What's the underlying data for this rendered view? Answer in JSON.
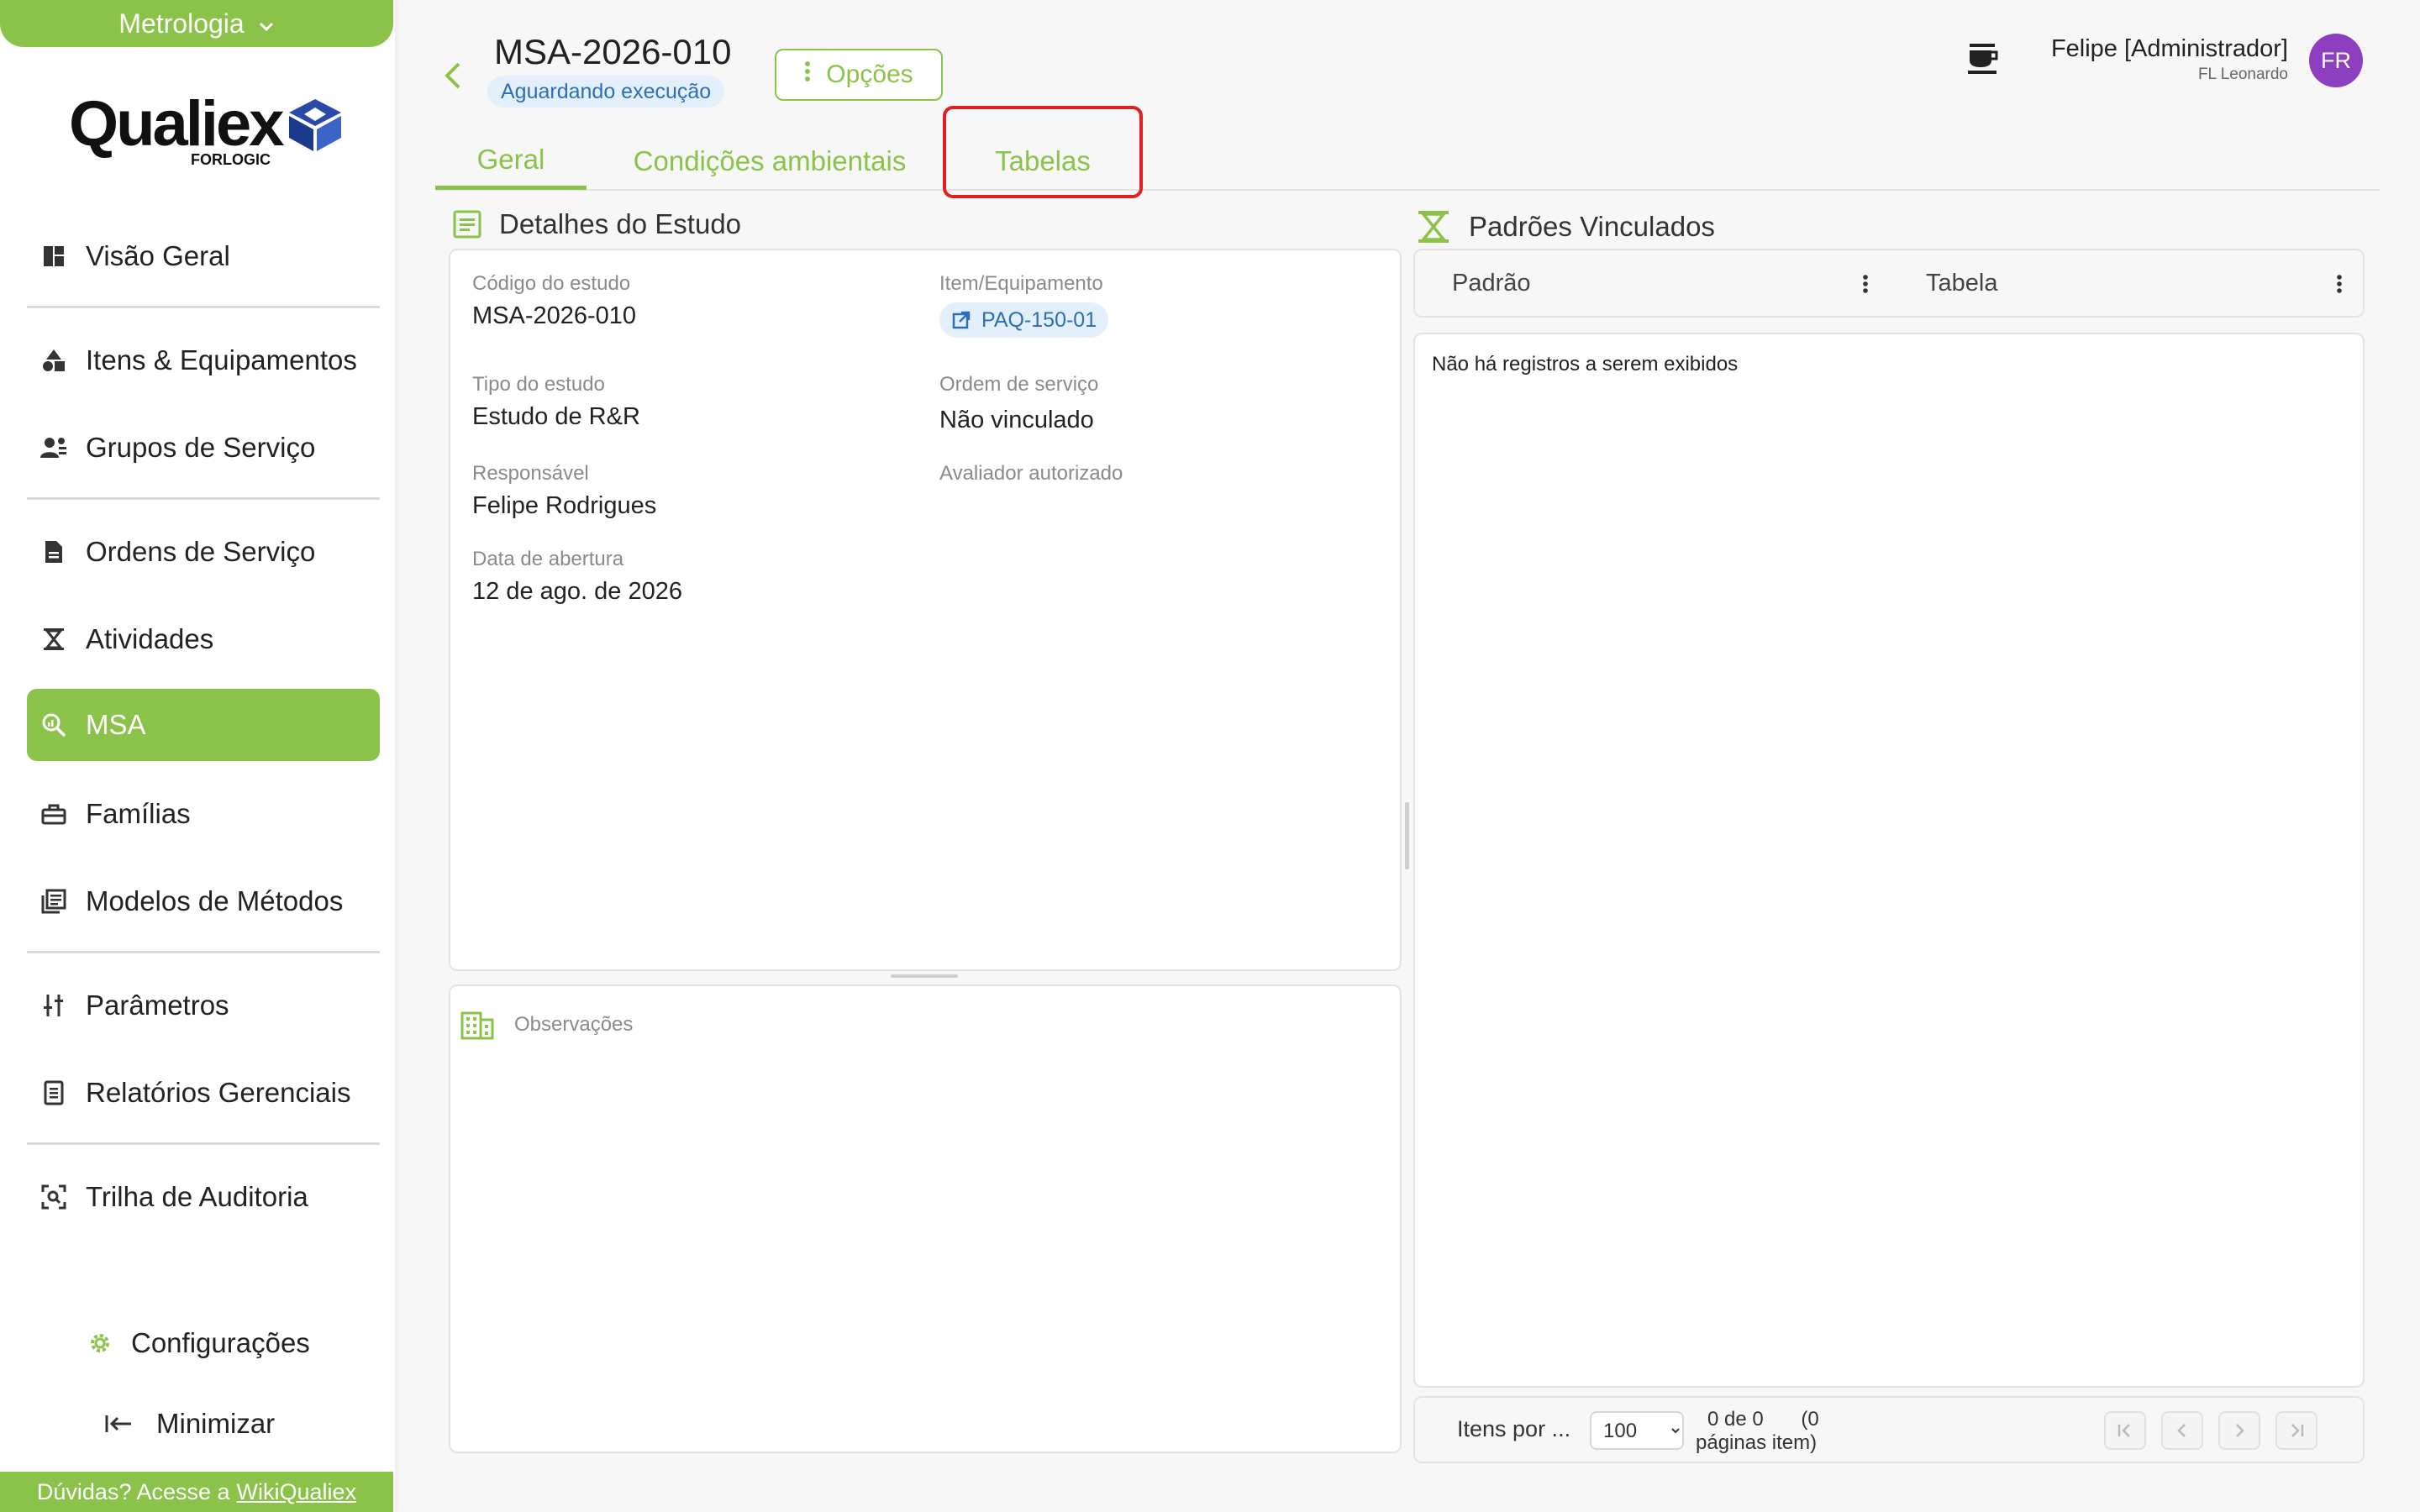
{
  "sidebar": {
    "module": "Metrologia",
    "logo": {
      "brand": "Qualiex",
      "sub": "FORLOGIC"
    },
    "items": [
      {
        "label": "Visão Geral",
        "icon": "dashboard-icon"
      },
      {
        "label": "Itens & Equipamentos",
        "icon": "shapes-icon"
      },
      {
        "label": "Grupos de Serviço",
        "icon": "group-icon"
      },
      {
        "label": "Ordens de Serviço",
        "icon": "document-icon"
      },
      {
        "label": "Atividades",
        "icon": "hourglass-icon"
      },
      {
        "label": "MSA",
        "icon": "analytics-icon"
      },
      {
        "label": "Famílias",
        "icon": "toolbox-icon"
      },
      {
        "label": "Modelos de Métodos",
        "icon": "library-icon"
      },
      {
        "label": "Parâmetros",
        "icon": "sliders-icon"
      },
      {
        "label": "Relatórios Gerenciais",
        "icon": "report-icon"
      },
      {
        "label": "Trilha de Auditoria",
        "icon": "audit-icon"
      }
    ],
    "settings": "Configurações",
    "minimize": "Minimizar",
    "help_text": "Dúvidas? Acesse a",
    "help_link": "WikiQualiex"
  },
  "header": {
    "title": "MSA-2026-010",
    "status": "Aguardando execução",
    "options_label": "Opções",
    "user_name": "Felipe [Administrador]",
    "user_org": "FL Leonardo",
    "avatar_initials": "FR"
  },
  "tabs": [
    {
      "label": "Geral"
    },
    {
      "label": "Condições ambientais"
    },
    {
      "label": "Tabelas"
    }
  ],
  "details": {
    "section_title": "Detalhes do Estudo",
    "fields": {
      "codigo_label": "Código do estudo",
      "codigo_value": "MSA-2026-010",
      "item_label": "Item/Equipamento",
      "item_value": "PAQ-150-01",
      "tipo_label": "Tipo do estudo",
      "tipo_value": "Estudo de R&R",
      "ordem_label": "Ordem de serviço",
      "ordem_value": "Não vinculado",
      "resp_label": "Responsável",
      "resp_value": "Felipe Rodrigues",
      "avaliador_label": "Avaliador autorizado",
      "data_label": "Data de abertura",
      "data_value": "12 de ago. de 2026"
    },
    "observacoes_label": "Observações"
  },
  "padroes": {
    "section_title": "Padrões Vinculados",
    "columns": [
      "Padrão",
      "Tabela"
    ],
    "empty_text": "Não há registros a serem exibidos",
    "pager": {
      "items_per_page_label": "Itens por ...",
      "page_size": "100",
      "count_line1": "0 de 0",
      "count_line1b": "(0",
      "count_line2": "páginas item)"
    }
  },
  "colors": {
    "accent": "#8bc34a",
    "badge_bg": "#e3f0fb",
    "badge_fg": "#2c6fb7",
    "avatar": "#8e3fbf",
    "highlight": "#e02020"
  }
}
